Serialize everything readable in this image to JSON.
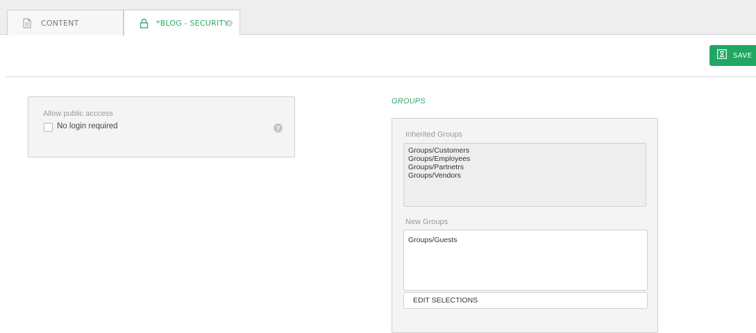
{
  "tabs": [
    {
      "label": "CONTENT",
      "icon": "document-icon",
      "active": false
    },
    {
      "label": "*BLOG - SECURITY",
      "icon": "lock-icon",
      "active": true
    }
  ],
  "toolbar": {
    "save_label": "SAVE",
    "accent": "#21a663"
  },
  "public_access": {
    "title": "Allow public acccess",
    "checkbox_label": "No login required",
    "checked": false,
    "help_symbol": "?"
  },
  "groups": {
    "heading": "GROUPS",
    "inherited_label": "Inherited Groups",
    "inherited": [
      "Groups/Customers",
      "Groups/Employees",
      "Groups/Partnetrs",
      "Groups/Vendors"
    ],
    "new_label": "New Groups",
    "new": [
      "Groups/Guests"
    ],
    "edit_label": "EDIT SELECTIONS"
  }
}
